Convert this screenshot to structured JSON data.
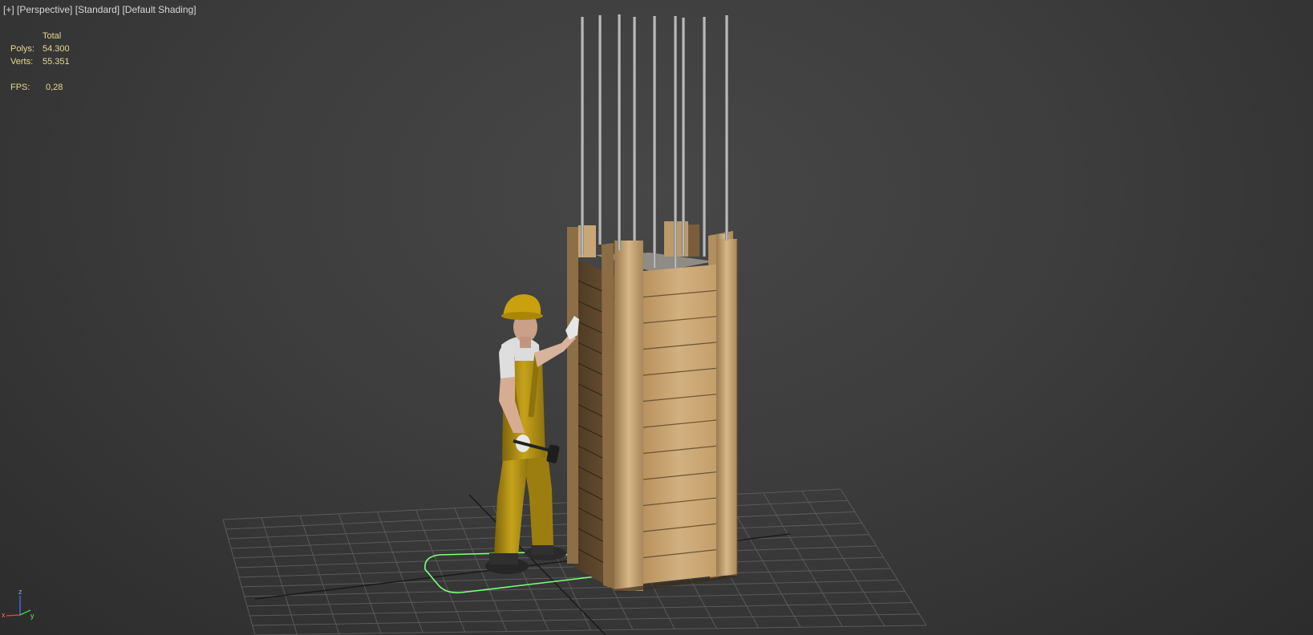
{
  "viewport": {
    "labels": [
      "[+]",
      "[Perspective]",
      "[Standard]",
      "[Default Shading]"
    ]
  },
  "stats": {
    "header": "Total",
    "polys_label": "Polys:",
    "polys_value": "54.300",
    "verts_label": "Verts:",
    "verts_value": "55.351",
    "fps_label": "FPS:",
    "fps_value": "0,28"
  },
  "axis_gizmo": {
    "z_label": "z",
    "x_label": "x",
    "y_label": "y"
  },
  "colors": {
    "stats_text": "#e8d890",
    "selection": "#7dff7d",
    "wood": "#c9a676",
    "overalls": "#b08e12"
  }
}
